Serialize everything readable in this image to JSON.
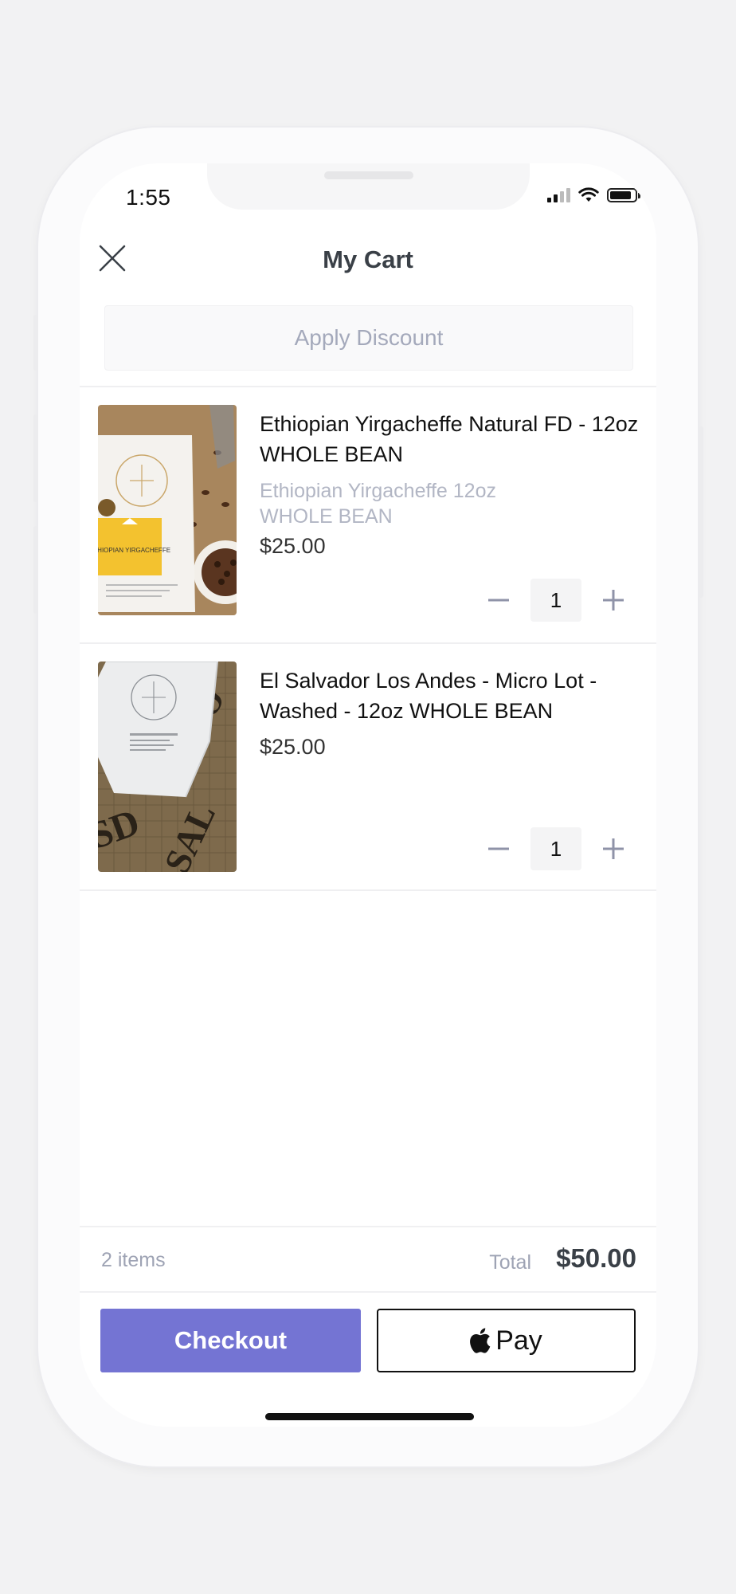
{
  "status_bar": {
    "time": "1:55"
  },
  "header": {
    "title": "My Cart"
  },
  "discount": {
    "label": "Apply Discount"
  },
  "items": [
    {
      "name": "Ethiopian Yirgacheffe Natural FD - 12oz WHOLE BEAN",
      "variant": "Ethiopian Yirgacheffe 12oz WHOLE BEAN",
      "price": "$25.00",
      "quantity": "1",
      "image_label": "ETHIOPIAN YIRGACHEFFE"
    },
    {
      "name": "El Salvador Los Andes - Micro Lot - Washed - 12oz WHOLE BEAN",
      "price": "$25.00",
      "quantity": "1"
    }
  ],
  "summary": {
    "items_count": "2 items",
    "total_label": "Total",
    "total_value": "$50.00"
  },
  "actions": {
    "checkout_label": "Checkout",
    "applepay_label": "Pay"
  },
  "colors": {
    "accent": "#7474d3",
    "muted_text": "#a4a9bb",
    "title_text": "#3a4047"
  }
}
